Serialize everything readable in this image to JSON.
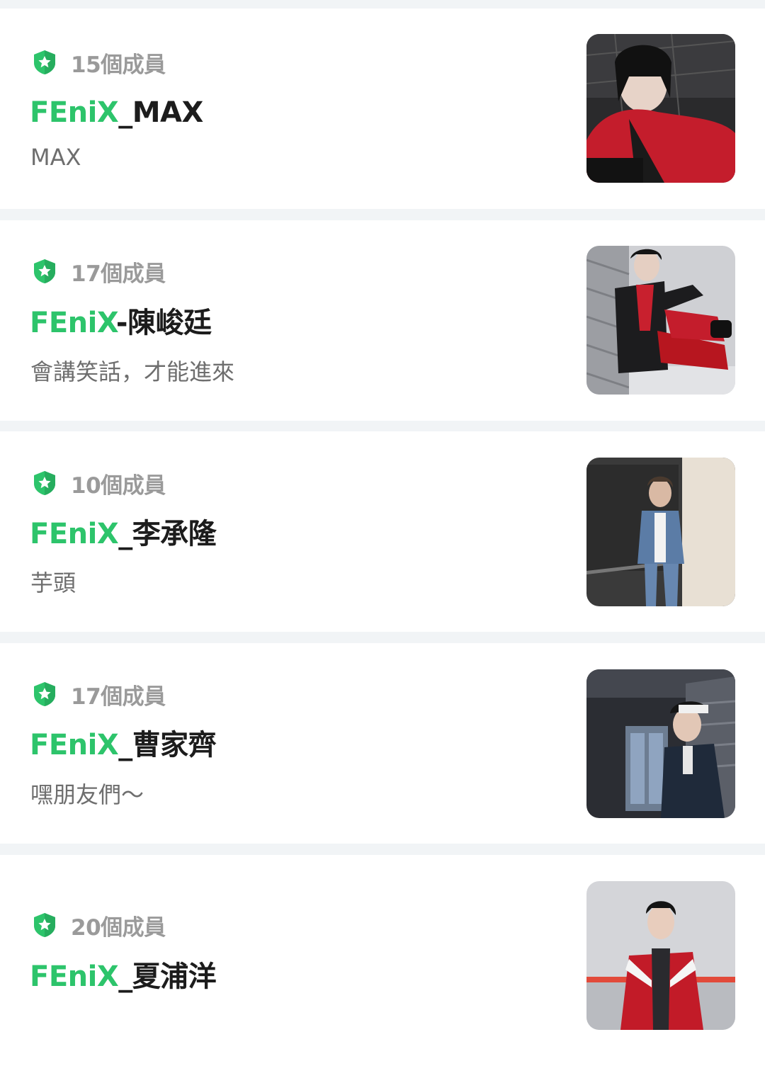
{
  "colors": {
    "accent_green": "#2dc46b",
    "title_text": "#1c1c1c",
    "muted_text": "#9a9a9a",
    "desc_text": "#6e6e6e",
    "separator": "#f1f4f6"
  },
  "rooms": [
    {
      "members": "15個成員",
      "title_prefix": "FEniX",
      "title_rest": "_MAX",
      "description": "MAX",
      "badge_icon": "shield-star-icon",
      "thumbnail": "photo-red-jacket-seated"
    },
    {
      "members": "17個成員",
      "title_prefix": "FEniX",
      "title_rest": "-陳峻廷",
      "description": "會講笑話，才能進來",
      "badge_icon": "shield-star-icon",
      "thumbnail": "photo-red-pants-seated"
    },
    {
      "members": "10個成員",
      "title_prefix": "FEniX",
      "title_rest": "_李承隆",
      "description": "芋頭",
      "badge_icon": "shield-star-icon",
      "thumbnail": "photo-denim-standing"
    },
    {
      "members": "17個成員",
      "title_prefix": "FEniX",
      "title_rest": "_曹家齊",
      "description": "嘿朋友們～",
      "badge_icon": "shield-star-icon",
      "thumbnail": "photo-cap-street"
    },
    {
      "members": "20個成員",
      "title_prefix": "FEniX",
      "title_rest": "_夏浦洋",
      "description": "",
      "badge_icon": "shield-star-icon",
      "thumbnail": "photo-red-track-jacket"
    }
  ]
}
